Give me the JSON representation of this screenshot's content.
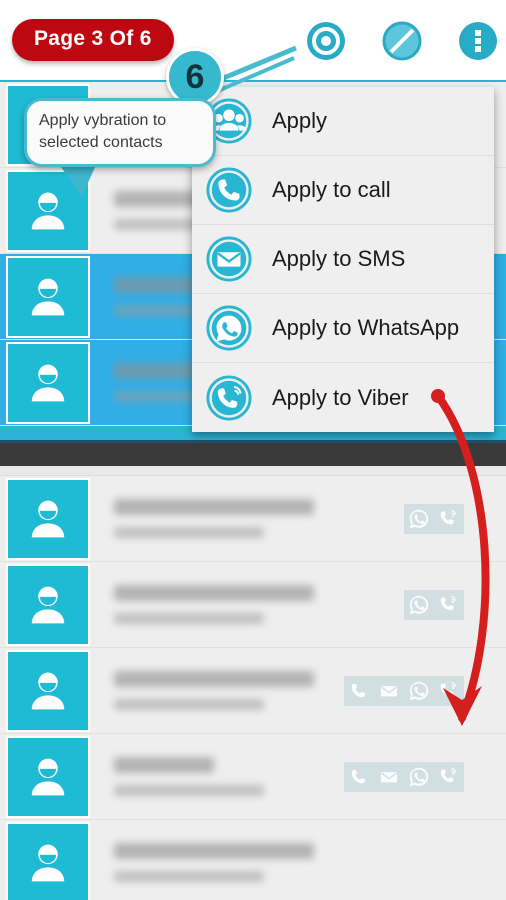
{
  "app": {
    "page_badge": "Page 3 Of 6",
    "accent_cyan": "#2CB4D6",
    "avatar_cyan": "#1FBBD4",
    "selected_blue": "#31AEE5",
    "badge_red": "#BE0811",
    "dark_band": "#3a3a3a",
    "list_bg": "#eeeeee",
    "arrow_red": "#D51F1F"
  },
  "toolbar": {
    "icons": [
      {
        "name": "record-target-icon",
        "label": "Select all"
      },
      {
        "name": "block-slash-icon",
        "label": "Deselect all"
      },
      {
        "name": "overflow-menu-icon",
        "label": "More options"
      }
    ]
  },
  "coachmark": {
    "step_number": "6",
    "tooltip_text": "Apply vybration to selected contacts"
  },
  "menu": {
    "items": [
      {
        "label": "Apply",
        "icon": "group-contacts-icon"
      },
      {
        "label": "Apply to call",
        "icon": "phone-icon"
      },
      {
        "label": "Apply to SMS",
        "icon": "envelope-icon"
      },
      {
        "label": "Apply to WhatsApp",
        "icon": "whatsapp-icon"
      },
      {
        "label": "Apply to Viber",
        "icon": "viber-icon"
      }
    ]
  },
  "contacts_top": [
    {
      "name": "Jawad Karamat Dar",
      "number": "+61 7089 881234",
      "selected": false,
      "actions": []
    },
    {
      "name": "Jawad Karamat Dar",
      "number": "+61 7081 481234",
      "selected": false,
      "actions": []
    },
    {
      "name": "Jawad Karamat Dar",
      "number": "+60 6343 881234",
      "selected": true,
      "actions": []
    },
    {
      "name": "Jawad Karamat Dar",
      "number": "+60 6343 881234",
      "selected": true,
      "actions": []
    }
  ],
  "contacts_bottom": [
    {
      "name": "Jawad Karamat Dar",
      "number": "+61 4289 631736",
      "selected": false,
      "actions": [
        "whatsapp-icon",
        "viber-icon"
      ]
    },
    {
      "name": "Jawad Karamat Dar",
      "number": "+61 7380 881234",
      "selected": false,
      "actions": [
        "whatsapp-icon",
        "viber-icon"
      ]
    },
    {
      "name": "Jawad Karamat Dar",
      "number": "+60 6428 687557",
      "selected": false,
      "actions": [
        "phone-icon",
        "envelope-icon",
        "whatsapp-icon",
        "viber-icon"
      ]
    },
    {
      "name": "Kamal Ali",
      "number": "+60 2334 665668",
      "selected": false,
      "actions": [
        "phone-icon",
        "envelope-icon",
        "whatsapp-icon",
        "viber-icon"
      ]
    },
    {
      "name": "Jawad Karamat Dar",
      "number": "+60 2334 665668",
      "selected": false,
      "actions": []
    }
  ]
}
